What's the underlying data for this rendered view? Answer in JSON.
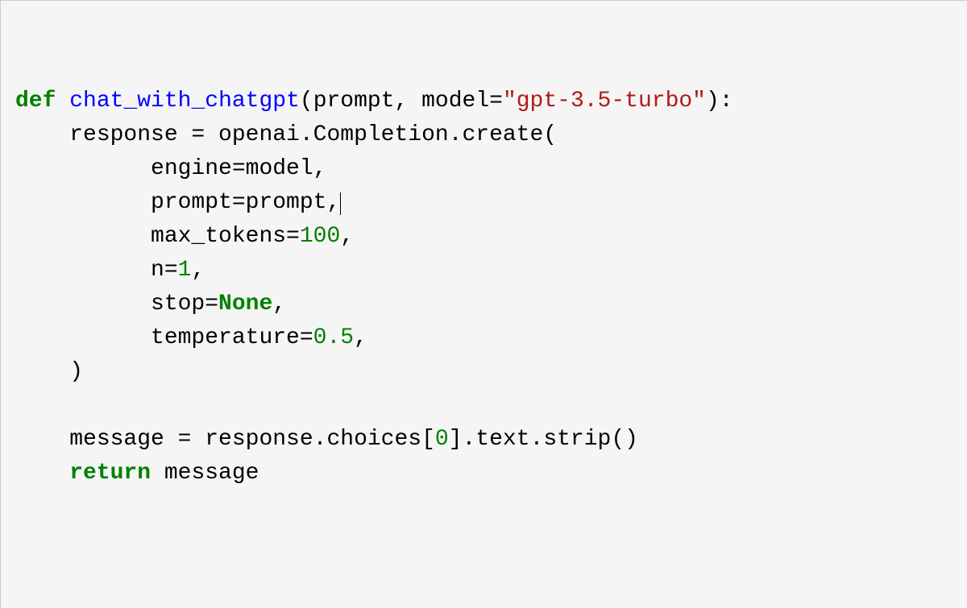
{
  "code": {
    "l1": {
      "def": "def",
      "fname": "chat_with_chatgpt",
      "p1": "(prompt, model=",
      "str": "\"gpt-3.5-turbo\"",
      "p2": "):"
    },
    "l2": "    response = openai.Completion.create(",
    "l3": "          engine=model,",
    "l4": "          prompt=prompt,",
    "l5a": "          max_tokens=",
    "l5n": "100",
    "l5c": ",",
    "l6a": "          n=",
    "l6n": "1",
    "l6c": ",",
    "l7a": "          stop=",
    "l7n": "None",
    "l7c": ",",
    "l8a": "          temperature=",
    "l8n": "0.5",
    "l8c": ",",
    "l9": "    )",
    "blank": "",
    "l11a": "    message = response.choices[",
    "l11n": "0",
    "l11b": "].text.strip()",
    "l12a": "    ",
    "l12k": "return",
    "l12b": " message"
  }
}
